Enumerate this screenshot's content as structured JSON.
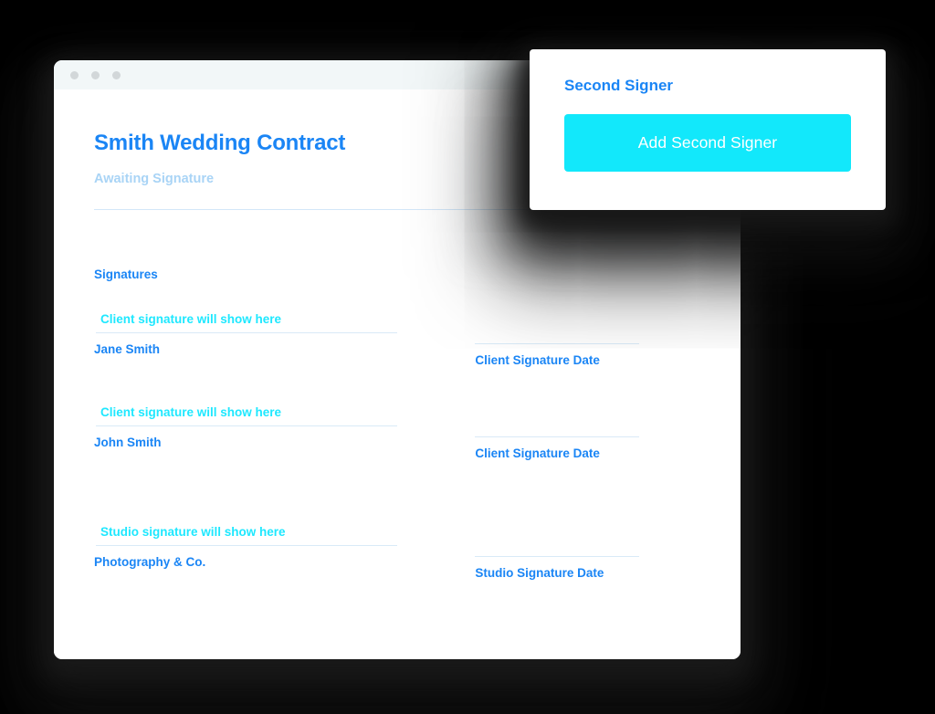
{
  "background_color": "#000000",
  "browser": {
    "titlebar": {
      "dots": [
        "window-dot-1",
        "window-dot-2",
        "window-dot-3"
      ],
      "dot_color": "#d2d7d9",
      "background_color": "#f2f7f8"
    },
    "document": {
      "title": "Smith Wedding Contract",
      "status": "Awaiting Signature",
      "title_color": "#1a85f5",
      "status_color": "#a9d4f6",
      "divider_color": "#d3e7f8",
      "signatures_heading": "Signatures",
      "signature_rows": [
        {
          "placeholder": "Client signature will show here",
          "name": "Jane Smith",
          "date_label": "Client Signature Date"
        },
        {
          "placeholder": "Client signature will show here",
          "name": "John Smith",
          "date_label": "Client Signature Date"
        },
        {
          "placeholder": "Studio signature will show here",
          "name": "Photography & Co.",
          "date_label": "Studio Signature Date"
        }
      ],
      "placeholder_color": "#1ee8ff",
      "line_color": "#d9eaf7"
    }
  },
  "popup_card": {
    "title": "Second Signer",
    "title_color": "#1a85f5",
    "button_label": "Add Second Signer",
    "button_color": "#12e8fb",
    "button_text_color": "#ffffff"
  }
}
